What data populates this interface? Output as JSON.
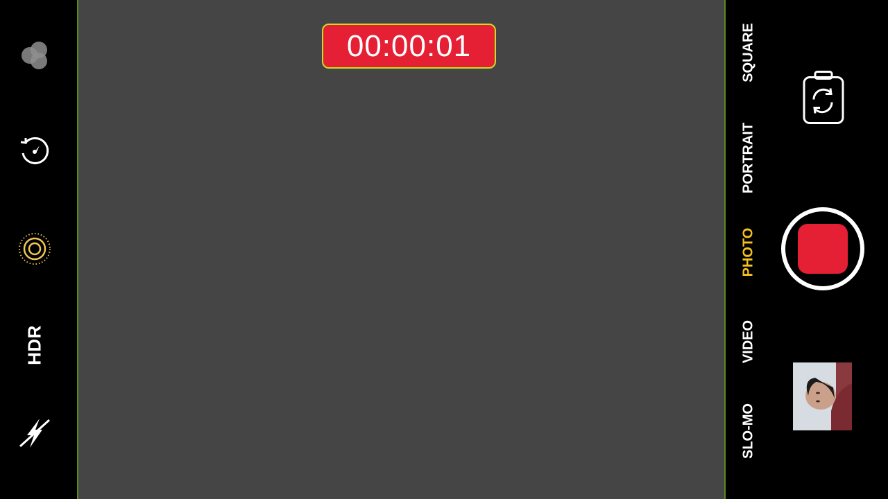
{
  "left_controls": {
    "live_photo": "live-photos-icon",
    "timer": "timer-icon",
    "filters": "filters-icon",
    "hdr_label": "HDR",
    "flash": "flash-off-icon"
  },
  "recording": {
    "elapsed": "00:00:01"
  },
  "modes": [
    {
      "label": "SQUARE",
      "active": false
    },
    {
      "label": "PORTRAIT",
      "active": false
    },
    {
      "label": "PHOTO",
      "active": true
    },
    {
      "label": "VIDEO",
      "active": false
    },
    {
      "label": "SLO-MO",
      "active": false
    }
  ],
  "colors": {
    "record_red": "#e51f34",
    "active_mode": "#f5c11e",
    "viewfinder": "#464546"
  }
}
